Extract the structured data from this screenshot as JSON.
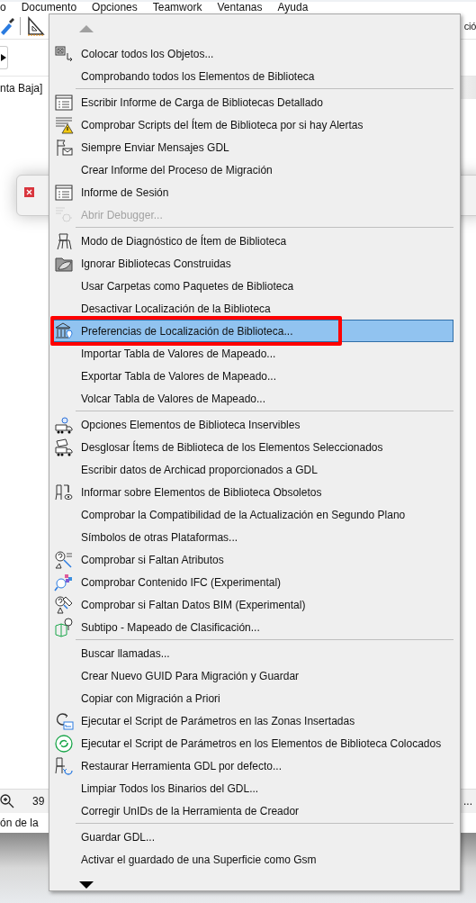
{
  "menubar": [
    "o",
    "Documento",
    "Opciones",
    "Teamwork",
    "Ventanas",
    "Ayuda"
  ],
  "toolbar_right_text": "ció",
  "story_label": "nta Baja]",
  "zoom_value": "39",
  "status_text": "ón de la",
  "status_right_text": "...",
  "menu": {
    "groups": [
      [
        {
          "label": "Colocar todos los Objetos...",
          "icon": true,
          "disabled": false,
          "selected": false,
          "annotated": false
        },
        {
          "label": "Comprobando todos los Elementos de Biblioteca",
          "icon": false,
          "disabled": false,
          "selected": false,
          "annotated": false
        }
      ],
      [
        {
          "label": "Escribir Informe de Carga de Bibliotecas Detallado",
          "icon": true,
          "disabled": false,
          "selected": false,
          "annotated": false
        },
        {
          "label": "Comprobar Scripts del Ítem de Biblioteca por si hay Alertas",
          "icon": true,
          "disabled": false,
          "selected": false,
          "annotated": false
        },
        {
          "label": "Siempre Enviar Mensajes GDL",
          "icon": true,
          "disabled": false,
          "selected": false,
          "annotated": false
        },
        {
          "label": "Crear Informe del Proceso de Migración",
          "icon": false,
          "disabled": false,
          "selected": false,
          "annotated": false
        },
        {
          "label": "Informe de Sesión",
          "icon": true,
          "disabled": false,
          "selected": false,
          "annotated": false
        },
        {
          "label": "Abrir Debugger...",
          "icon": true,
          "disabled": true,
          "selected": false,
          "annotated": false
        }
      ],
      [
        {
          "label": "Modo de Diagnóstico de Ítem de Biblioteca",
          "icon": true,
          "disabled": false,
          "selected": false,
          "annotated": false
        },
        {
          "label": "Ignorar Bibliotecas Construidas",
          "icon": true,
          "disabled": false,
          "selected": false,
          "annotated": false
        },
        {
          "label": "Usar Carpetas como Paquetes de Biblioteca",
          "icon": false,
          "disabled": false,
          "selected": false,
          "annotated": false
        },
        {
          "label": "Desactivar Localización de la Biblioteca",
          "icon": false,
          "disabled": false,
          "selected": false,
          "annotated": false
        },
        {
          "label": "Preferencias de Localización de Biblioteca...",
          "icon": true,
          "disabled": false,
          "selected": true,
          "annotated": true
        },
        {
          "label": "Importar Tabla de Valores de Mapeado...",
          "icon": false,
          "disabled": false,
          "selected": false,
          "annotated": false
        },
        {
          "label": "Exportar Tabla de Valores de Mapeado...",
          "icon": false,
          "disabled": false,
          "selected": false,
          "annotated": false
        },
        {
          "label": "Volcar Tabla de Valores de Mapeado...",
          "icon": false,
          "disabled": false,
          "selected": false,
          "annotated": false
        }
      ],
      [
        {
          "label": "Opciones Elementos de Biblioteca Inservibles",
          "icon": true,
          "disabled": false,
          "selected": false,
          "annotated": false
        },
        {
          "label": "Desglosar Ítems de Biblioteca de los Elementos Seleccionados",
          "icon": true,
          "disabled": false,
          "selected": false,
          "annotated": false
        },
        {
          "label": "Escribir datos de Archicad proporcionados a GDL",
          "icon": false,
          "disabled": false,
          "selected": false,
          "annotated": false
        },
        {
          "label": "Informar sobre Elementos de Biblioteca Obsoletos",
          "icon": true,
          "disabled": false,
          "selected": false,
          "annotated": false
        },
        {
          "label": "Comprobar la Compatibilidad de la Actualización en Segundo Plano",
          "icon": false,
          "disabled": false,
          "selected": false,
          "annotated": false
        },
        {
          "label": "Símbolos de otras Plataformas...",
          "icon": false,
          "disabled": false,
          "selected": false,
          "annotated": false
        },
        {
          "label": "Comprobar si Faltan Atributos",
          "icon": true,
          "disabled": false,
          "selected": false,
          "annotated": false
        },
        {
          "label": "Comprobar Contenido IFC (Experimental)",
          "icon": true,
          "disabled": false,
          "selected": false,
          "annotated": false
        },
        {
          "label": "Comprobar si Faltan Datos BIM (Experimental)",
          "icon": true,
          "disabled": false,
          "selected": false,
          "annotated": false
        },
        {
          "label": "Subtipo - Mapeado de Clasificación...",
          "icon": true,
          "disabled": false,
          "selected": false,
          "annotated": false
        }
      ],
      [
        {
          "label": "Buscar llamadas...",
          "icon": false,
          "disabled": false,
          "selected": false,
          "annotated": false
        },
        {
          "label": "Crear Nuevo GUID Para Migración y Guardar",
          "icon": false,
          "disabled": false,
          "selected": false,
          "annotated": false
        },
        {
          "label": "Copiar con Migración a Priori",
          "icon": false,
          "disabled": false,
          "selected": false,
          "annotated": false
        },
        {
          "label": "Ejecutar el Script de Parámetros en las Zonas Insertadas",
          "icon": true,
          "disabled": false,
          "selected": false,
          "annotated": false
        },
        {
          "label": "Ejecutar el Script de Parámetros en los Elementos de Biblioteca Colocados",
          "icon": true,
          "disabled": false,
          "selected": false,
          "annotated": false
        },
        {
          "label": "Restaurar Herramienta GDL por defecto...",
          "icon": true,
          "disabled": false,
          "selected": false,
          "annotated": false
        },
        {
          "label": "Limpiar Todos los Binarios del GDL...",
          "icon": false,
          "disabled": false,
          "selected": false,
          "annotated": false
        },
        {
          "label": "Corregir UnIDs de la Herramienta de Creador",
          "icon": false,
          "disabled": false,
          "selected": false,
          "annotated": false
        }
      ],
      [
        {
          "label": "Guardar GDL...",
          "icon": false,
          "disabled": false,
          "selected": false,
          "annotated": false
        },
        {
          "label": "Activar el guardado de una Superficie como Gsm",
          "icon": false,
          "disabled": false,
          "selected": false,
          "annotated": false
        }
      ]
    ]
  }
}
